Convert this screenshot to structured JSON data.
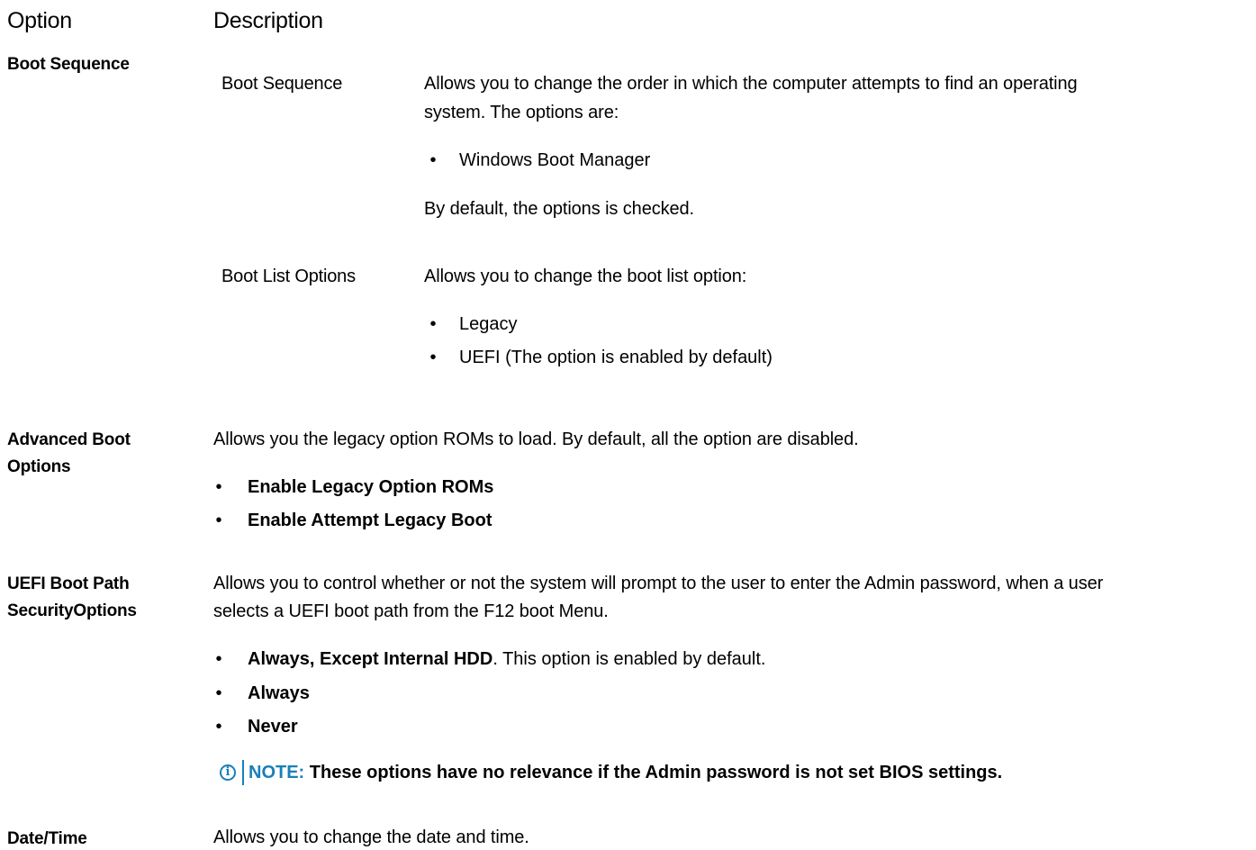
{
  "header": {
    "option_label": "Option",
    "description_label": "Description"
  },
  "boot_sequence": {
    "option_label": "Boot Sequence",
    "sub1_name": "Boot Sequence",
    "sub1_desc_line1": "Allows you to change the order in which the computer attempts to find an operating",
    "sub1_desc_line2": "system. The options are:",
    "sub1_bullet1": "Windows Boot Manager",
    "sub1_default": "By default, the options is checked.",
    "sub2_name": "Boot List Options",
    "sub2_desc": "Allows you to change the boot list option:",
    "sub2_bullet1": "Legacy",
    "sub2_bullet2": "UEFI (The option is enabled by default)"
  },
  "advanced_boot": {
    "option_line1": "Advanced Boot",
    "option_line2": "Options",
    "desc": "Allows you the legacy option ROMs to load. By default, all the option are disabled.",
    "bullet1": "Enable Legacy Option ROMs",
    "bullet2": "Enable Attempt Legacy Boot"
  },
  "uefi_boot_path": {
    "option_line1": "UEFI Boot Path",
    "option_line2": "SecurityOptions",
    "desc_line1": "Allows you to control whether or not the system will prompt to the user to enter the Admin password, when a user",
    "desc_line2": "selects a UEFI boot path from the F12 boot Menu.",
    "bullet1_bold": "Always, Except Internal HDD",
    "bullet1_rest": ". This option is enabled by default.",
    "bullet2": "Always",
    "bullet3": "Never",
    "note_label": "NOTE:",
    "note_text": " These options have no relevance if the Admin password is not set BIOS settings."
  },
  "date_time": {
    "option_label": "Date/Time",
    "desc": "Allows you to change the date and time."
  },
  "bullet_char": "•",
  "note_icon_char": "i",
  "colors": {
    "note_accent": "#1a7fb8"
  }
}
